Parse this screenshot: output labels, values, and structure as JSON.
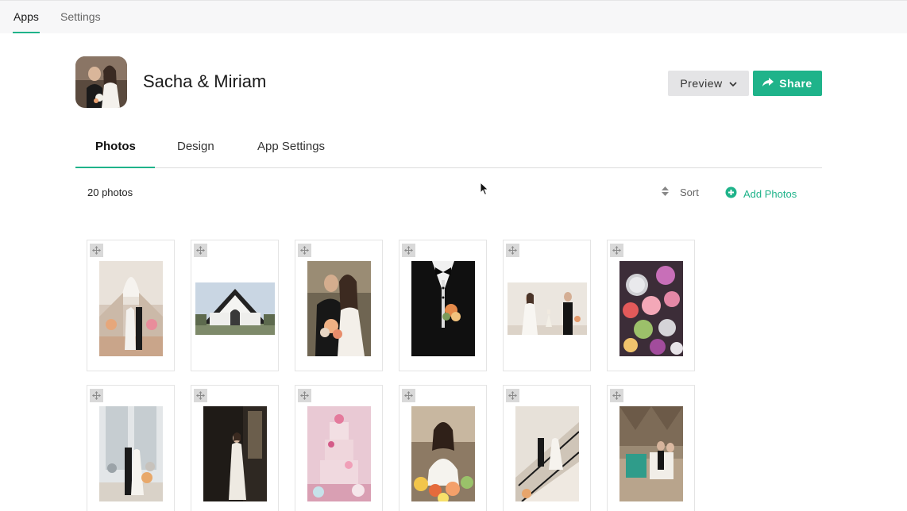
{
  "topnav": {
    "apps": "Apps",
    "settings": "Settings"
  },
  "header": {
    "title": "Sacha & Miriam",
    "preview_label": "Preview",
    "share_label": "Share"
  },
  "tabs": {
    "photos": "Photos",
    "design": "Design",
    "app_settings": "App Settings"
  },
  "toolbar": {
    "count": "20 photos",
    "sort": "Sort",
    "add_photos": "Add Photos"
  },
  "colors": {
    "accent": "#1fb38a",
    "preview_bg": "#e4e4e6"
  },
  "icons": [
    "share-icon",
    "chevron-down-icon",
    "sort-icon",
    "plus-circle-icon",
    "drag-handle-icon",
    "mouse-cursor-icon"
  ]
}
